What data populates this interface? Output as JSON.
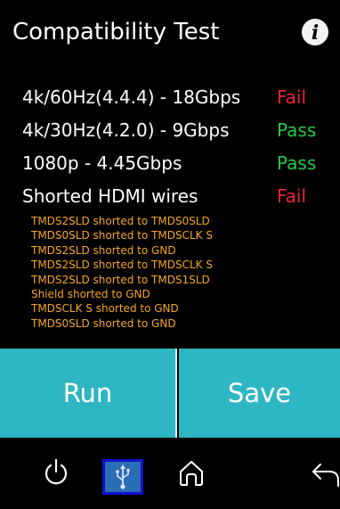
{
  "header": {
    "title": "Compatibility Test",
    "info_glyph": "i"
  },
  "results": [
    {
      "label": "4k/60Hz(4.4.4) - 18Gbps",
      "status": "Fail"
    },
    {
      "label": "4k/30Hz(4.2.0) - 9Gbps",
      "status": "Pass"
    },
    {
      "label": "1080p - 4.45Gbps",
      "status": "Pass"
    },
    {
      "label": "Shorted HDMI wires",
      "status": "Fail"
    }
  ],
  "details": [
    "TMDS2SLD shorted to TMDS0SLD",
    "TMDS0SLD shorted to TMDSCLK S",
    "TMDS2SLD shorted to GND",
    "TMDS2SLD shorted to TMDSCLK S",
    "TMDS2SLD shorted to TMDS1SLD",
    "Shield shorted to GND",
    "TMDSCLK S shorted to GND",
    "TMDS0SLD shorted to GND"
  ],
  "actions": {
    "run_label": "Run",
    "save_label": "Save"
  },
  "nav": {
    "icons": [
      "power-icon",
      "usb-icon",
      "home-icon",
      "back-icon"
    ]
  },
  "colors": {
    "background": "#000000",
    "fail": "#ee2233",
    "pass": "#22cc44",
    "detail_text": "#f5a623",
    "button": "#2eb6c2",
    "usb_selected": "#2a6eb5"
  }
}
